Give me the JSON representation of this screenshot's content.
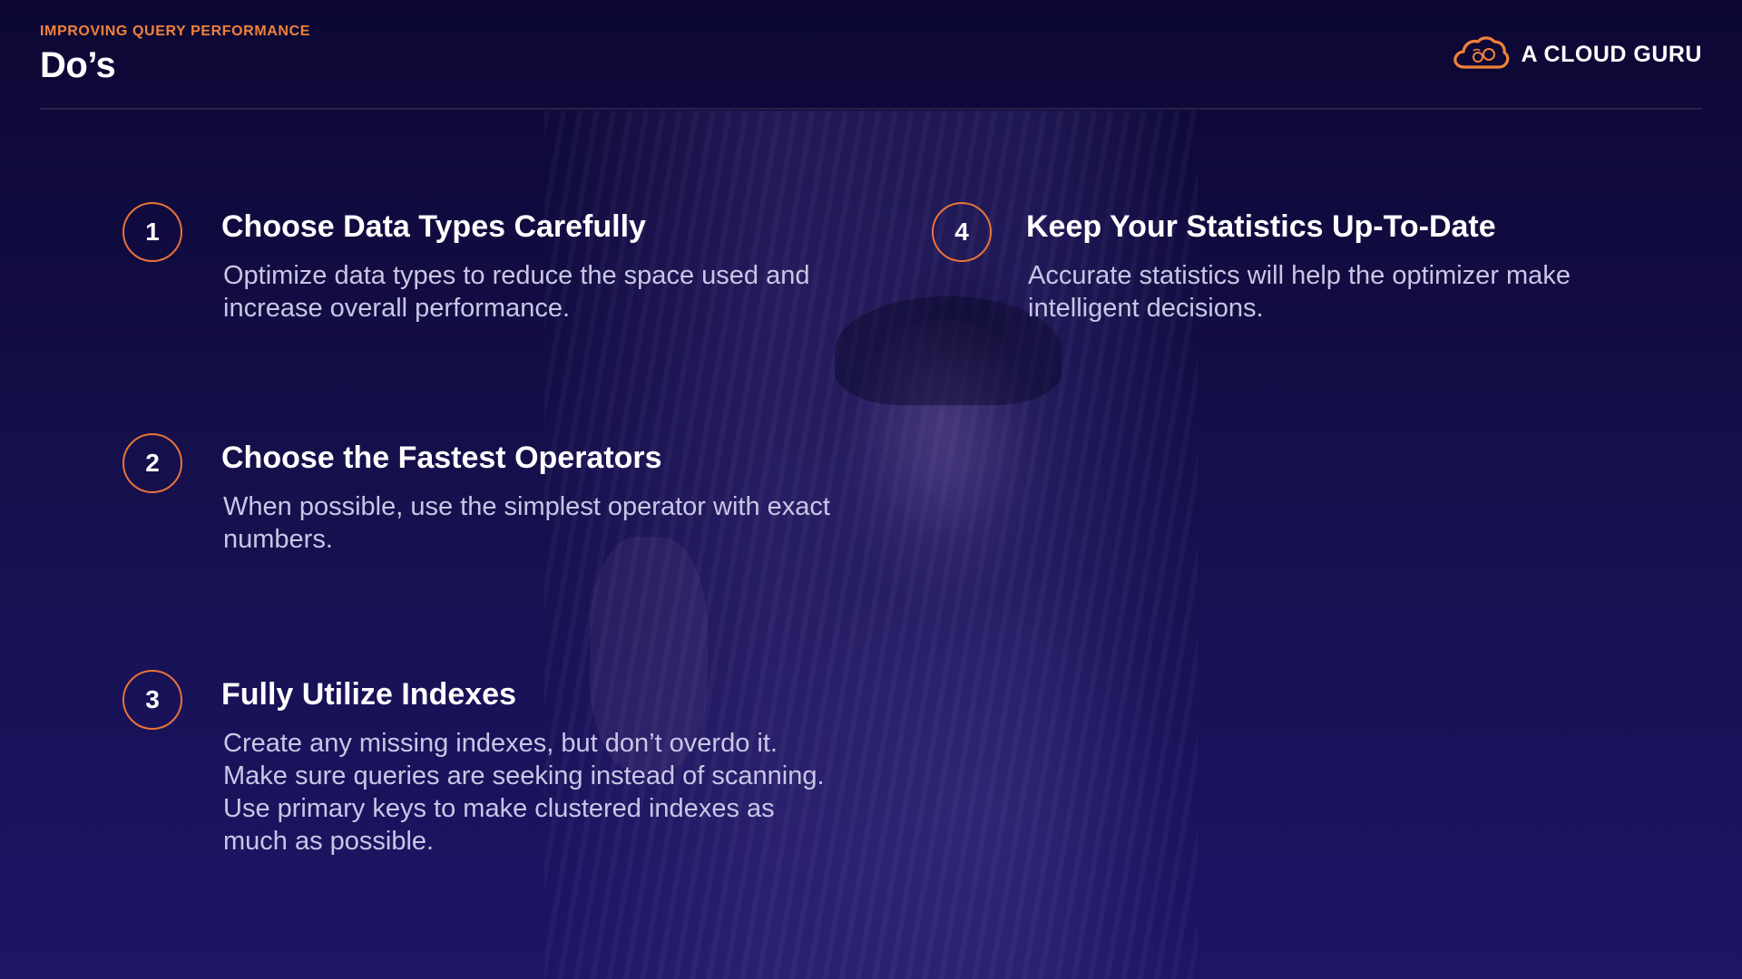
{
  "header": {
    "eyebrow": "IMPROVING QUERY PERFORMANCE",
    "title": "Do’s"
  },
  "brand": {
    "name": "A CLOUD GURU",
    "logo_icon": "cloud-logo-icon",
    "accent_color": "#f0813a"
  },
  "items": [
    {
      "number": "1",
      "title": "Choose Data Types Carefully",
      "description": "Optimize data types to reduce the space used and increase overall performance."
    },
    {
      "number": "2",
      "title": "Choose the Fastest Operators",
      "description": "When possible, use the simplest operator with exact numbers."
    },
    {
      "number": "3",
      "title": "Fully Utilize Indexes",
      "description": "Create any missing indexes, but don’t overdo it. Make sure queries are seeking instead of scanning. Use primary keys to make clustered indexes as much as possible."
    },
    {
      "number": "4",
      "title": "Keep Your Statistics Up-To-Date",
      "description": "Accurate statistics will help the optimizer make intelligent decisions."
    }
  ]
}
